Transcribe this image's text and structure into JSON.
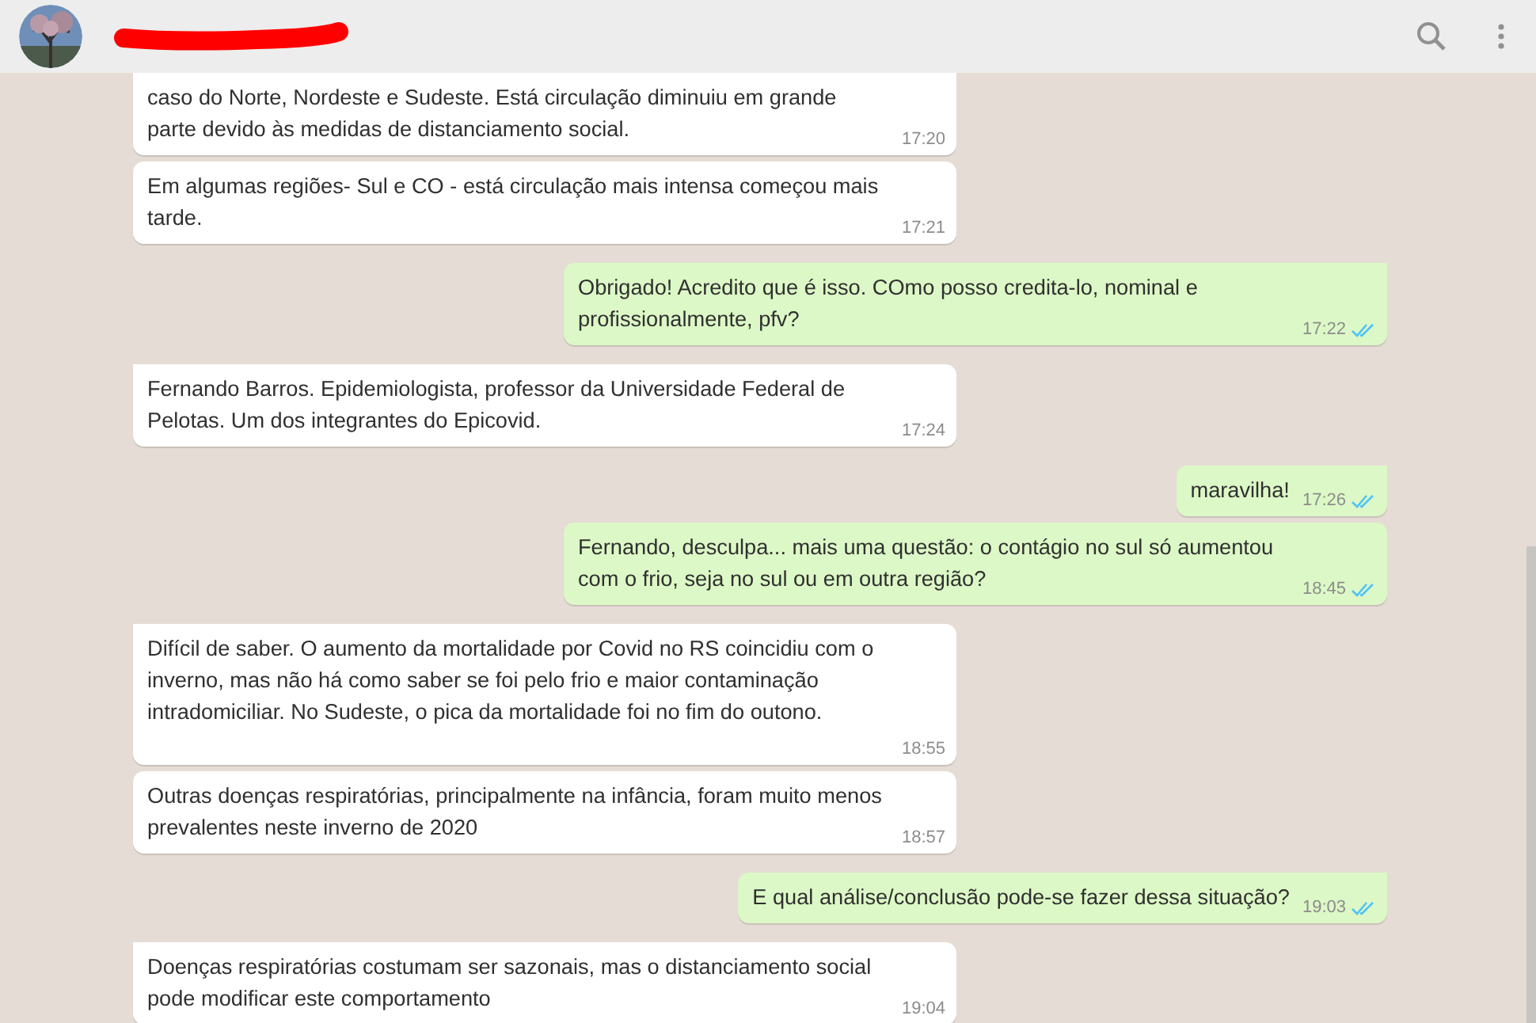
{
  "header": {
    "name_redacted": true
  },
  "messages": [
    {
      "kind": "incoming",
      "cut_top": true,
      "text": "caso do Norte, Nordeste e Sudeste. Está circulação diminuiu em grande parte devido às medidas de distanciamento social.",
      "time": "17:20"
    },
    {
      "kind": "incoming",
      "tail": false,
      "text": "Em algumas regiões- Sul e CO - está circulação mais intensa começou mais tarde.",
      "time": "17:21"
    },
    {
      "kind": "outgoing",
      "tail": true,
      "text": "Obrigado! Acredito que é isso. COmo posso credita-lo, nominal e profissionalmente, pfv?",
      "time": "17:22",
      "read": true
    },
    {
      "kind": "incoming",
      "tail": true,
      "text": "Fernando Barros. Epidemiologista, professor da Universidade Federal de Pelotas. Um dos integrantes do Epicovid.",
      "time": "17:24"
    },
    {
      "kind": "outgoing",
      "tail": true,
      "text": "maravilha!",
      "time": "17:26",
      "read": true
    },
    {
      "kind": "outgoing",
      "tail": false,
      "text": "Fernando, desculpa... mais uma questão: o contágio no sul só aumentou com o frio, seja no sul ou em outra região?",
      "time": "18:45",
      "read": true
    },
    {
      "kind": "incoming",
      "tail": true,
      "text": "Difícil de saber. O aumento da mortalidade por Covid no RS coincidiu com o inverno, mas não há como saber se foi pelo frio e maior contaminação intradomiciliar. No Sudeste, o pica da mortalidade foi no fim do outono.",
      "time": "18:55",
      "own_line_time": true
    },
    {
      "kind": "incoming",
      "tail": false,
      "text": "Outras doenças respiratórias, principalmente na infância, foram muito menos prevalentes neste inverno de 2020",
      "time": "18:57"
    },
    {
      "kind": "outgoing",
      "tail": true,
      "text": "E qual análise/conclusão pode-se fazer dessa situação?",
      "time": "19:03",
      "read": true
    },
    {
      "kind": "incoming",
      "tail": true,
      "text": "Doenças respiratórias costumam ser sazonais, mas o distanciamento social pode modificar este comportamento",
      "time": "19:04"
    }
  ]
}
